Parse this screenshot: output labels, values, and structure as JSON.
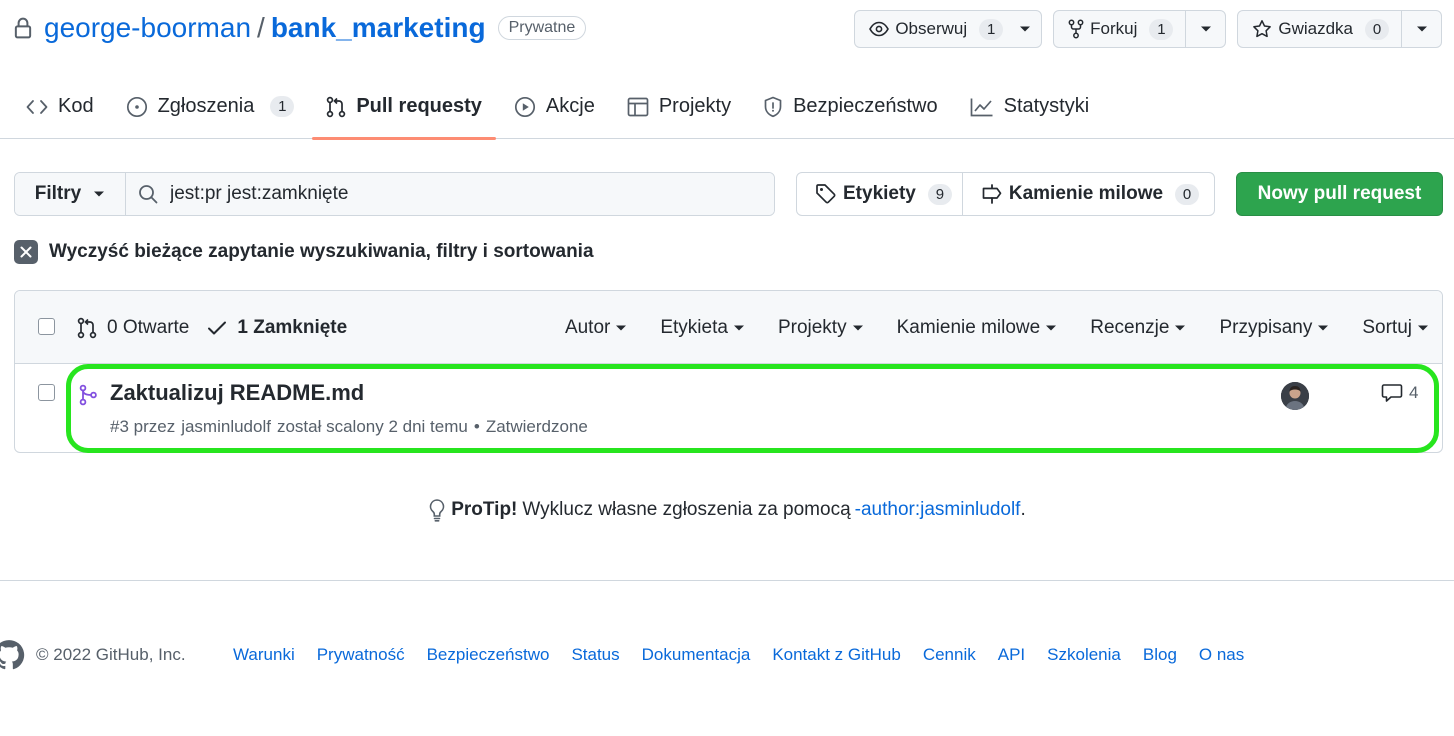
{
  "repo": {
    "owner": "george-boorman",
    "separator": "/",
    "name": "bank_marketing",
    "visibility": "Prywatne"
  },
  "actions": {
    "watch_label": "Obserwuj",
    "watch_count": "1",
    "fork_label": "Forkuj",
    "fork_count": "1",
    "star_label": "Gwiazdka",
    "star_count": "0"
  },
  "nav": {
    "tabs": [
      {
        "label": "Kod",
        "icon": "code-icon"
      },
      {
        "label": "Zgłoszenia",
        "icon": "issue-opened-icon",
        "count": "1"
      },
      {
        "label": "Pull requesty",
        "icon": "git-pull-request-icon",
        "selected": true
      },
      {
        "label": "Akcje",
        "icon": "play-icon"
      },
      {
        "label": "Projekty",
        "icon": "table-icon"
      },
      {
        "label": "Bezpieczeństwo",
        "icon": "shield-icon"
      },
      {
        "label": "Statystyki",
        "icon": "graph-icon"
      }
    ]
  },
  "subnav": {
    "filters_label": "Filtry",
    "search_value": "jest:pr jest:zamknięte",
    "labels_label": "Etykiety",
    "labels_count": "9",
    "milestones_label": "Kamienie milowe",
    "milestones_count": "0",
    "new_pr_label": "Nowy pull request"
  },
  "clear_query": "Wyczyść bieżące zapytanie wyszukiwania, filtry i sortowania",
  "list": {
    "open_label": "0 Otwarte",
    "closed_label": "1 Zamknięte",
    "sorts": [
      "Autor",
      "Etykieta",
      "Projekty",
      "Kamienie milowe",
      "Recenzje",
      "Przypisany",
      "Sortuj"
    ],
    "items": [
      {
        "title": "Zaktualizuj README.md",
        "meta_prefix": "#3 przez",
        "author": "jasminludolf",
        "meta_suffix": "został scalony 2 dni temu",
        "bullet": "•",
        "review_status": "Zatwierdzone",
        "comments": "4",
        "status_icon": "git-merge-icon",
        "status_color": "#8250df"
      }
    ]
  },
  "protip": {
    "bold": "ProTip!",
    "text": "Wyklucz własne zgłoszenia za pomocą",
    "link": "-author:jasminludolf",
    "end": "."
  },
  "footer": {
    "copyright": "© 2022 GitHub, Inc.",
    "links": [
      "Warunki",
      "Prywatność",
      "Bezpieczeństwo",
      "Status",
      "Dokumentacja",
      "Kontakt z GitHub",
      "Cennik",
      "API",
      "Szkolenia",
      "Blog",
      "O nas"
    ]
  },
  "colors": {
    "accent_blue": "#0969da",
    "success_green": "#2da44e",
    "merged_purple": "#8250df",
    "highlight_green": "#27e51e",
    "tab_underline": "#fd8c73"
  }
}
